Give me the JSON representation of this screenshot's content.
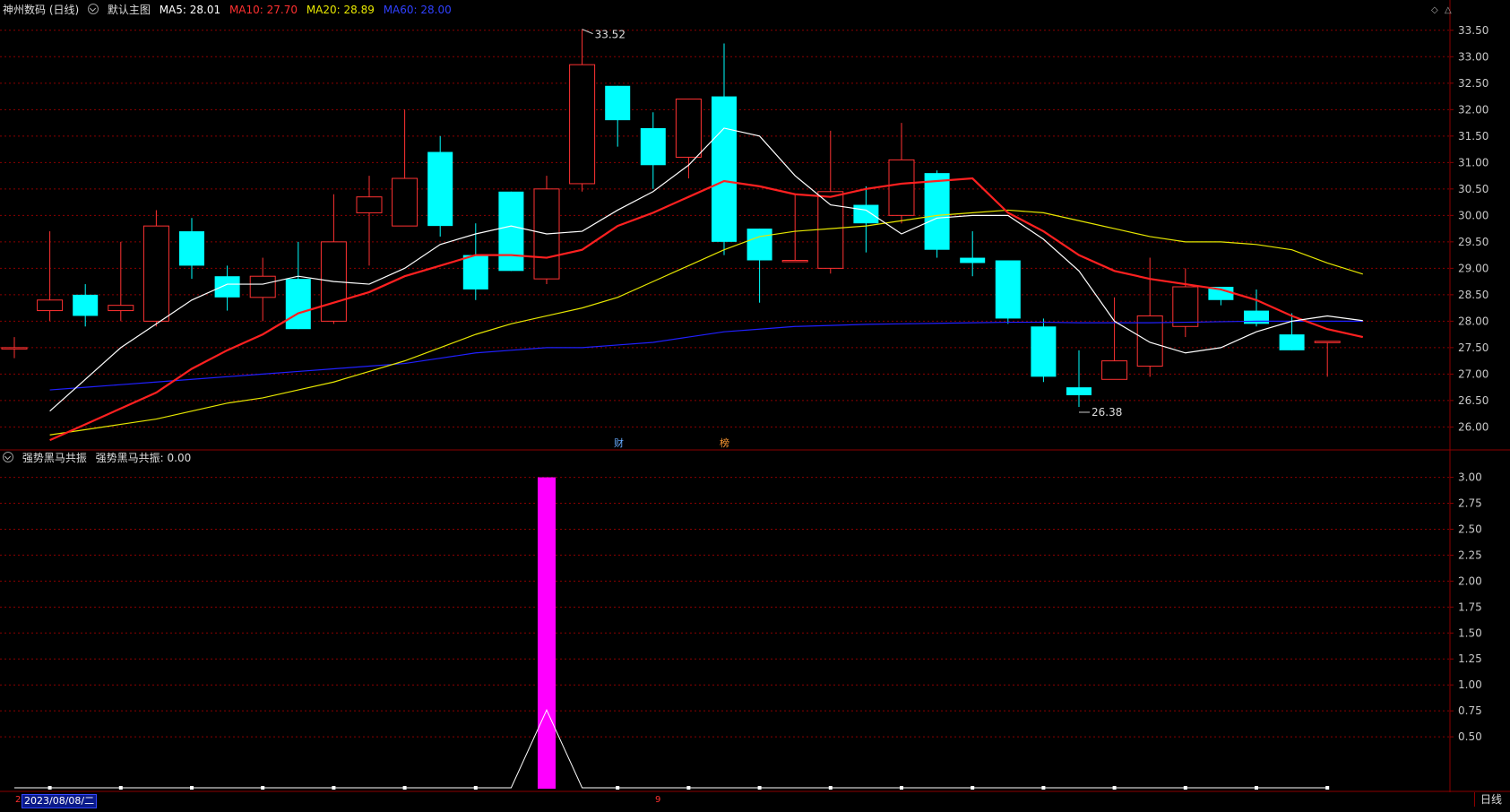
{
  "header": {
    "stock_title": "神州数码 (日线)",
    "main_chart_name": "默认主图",
    "ma5": "MA5: 28.01",
    "ma10": "MA10: 27.70",
    "ma20": "MA20: 28.89",
    "ma60": "MA60: 28.00"
  },
  "indicator": {
    "title": "强势黑马共振",
    "value_text": "强势黑马共振: 0.00"
  },
  "markers": {
    "high_label": "33.52",
    "low_label": "26.38",
    "fin_badge": "财",
    "rank_badge": "榜"
  },
  "footer": {
    "date": "2023/08/08/二",
    "period_button": "日线",
    "left_mark": "2",
    "mid_mark": "9"
  },
  "colors": {
    "up": "#ff3232",
    "down": "#00ffff",
    "ma5": "#ffffff",
    "ma10": "#ff2020",
    "ma20": "#e6e600",
    "ma60": "#2020ff",
    "indicator_bar": "#ff00ff",
    "grid": "#8b0000"
  },
  "chart_data": [
    {
      "type": "candlestick",
      "title": "神州数码 (日线)",
      "ylim": [
        25.6,
        33.7
      ],
      "yticks": [
        "33.50",
        "33.00",
        "32.50",
        "32.00",
        "31.50",
        "31.00",
        "30.50",
        "30.00",
        "29.50",
        "29.00",
        "28.50",
        "28.00",
        "27.50",
        "27.00",
        "26.50",
        "26.00"
      ],
      "candles": [
        {
          "o": 27.5,
          "h": 27.7,
          "l": 27.3,
          "c": 27.5
        },
        {
          "o": 28.2,
          "h": 29.7,
          "l": 28.0,
          "c": 28.4
        },
        {
          "o": 28.5,
          "h": 28.7,
          "l": 27.9,
          "c": 28.1
        },
        {
          "o": 28.2,
          "h": 29.5,
          "l": 28.0,
          "c": 28.3
        },
        {
          "o": 28.0,
          "h": 30.1,
          "l": 27.9,
          "c": 29.8
        },
        {
          "o": 29.7,
          "h": 29.95,
          "l": 28.8,
          "c": 29.05
        },
        {
          "o": 28.85,
          "h": 29.05,
          "l": 28.2,
          "c": 28.45
        },
        {
          "o": 28.45,
          "h": 29.2,
          "l": 28.0,
          "c": 28.85
        },
        {
          "o": 28.8,
          "h": 29.5,
          "l": 27.85,
          "c": 27.85
        },
        {
          "o": 28.0,
          "h": 30.4,
          "l": 27.95,
          "c": 29.5
        },
        {
          "o": 30.05,
          "h": 30.75,
          "l": 29.05,
          "c": 30.35
        },
        {
          "o": 29.8,
          "h": 32.0,
          "l": 29.8,
          "c": 30.7
        },
        {
          "o": 31.2,
          "h": 31.5,
          "l": 29.6,
          "c": 29.8
        },
        {
          "o": 29.25,
          "h": 29.85,
          "l": 28.4,
          "c": 28.6
        },
        {
          "o": 30.45,
          "h": 30.45,
          "l": 28.95,
          "c": 28.95
        },
        {
          "o": 28.8,
          "h": 30.75,
          "l": 28.7,
          "c": 30.5
        },
        {
          "o": 30.6,
          "h": 33.52,
          "l": 30.45,
          "c": 32.85
        },
        {
          "o": 32.45,
          "h": 32.45,
          "l": 31.3,
          "c": 31.8
        },
        {
          "o": 31.65,
          "h": 31.95,
          "l": 30.5,
          "c": 30.95
        },
        {
          "o": 31.1,
          "h": 32.2,
          "l": 30.7,
          "c": 32.2
        },
        {
          "o": 32.25,
          "h": 33.25,
          "l": 29.25,
          "c": 29.5
        },
        {
          "o": 29.75,
          "h": 29.75,
          "l": 28.35,
          "c": 29.15
        },
        {
          "o": 29.15,
          "h": 30.4,
          "l": 29.15,
          "c": 29.15
        },
        {
          "o": 29.0,
          "h": 31.6,
          "l": 28.9,
          "c": 30.45
        },
        {
          "o": 30.2,
          "h": 30.55,
          "l": 29.3,
          "c": 29.85
        },
        {
          "o": 30.0,
          "h": 31.75,
          "l": 29.85,
          "c": 31.05
        },
        {
          "o": 30.8,
          "h": 30.85,
          "l": 29.2,
          "c": 29.35
        },
        {
          "o": 29.2,
          "h": 29.7,
          "l": 28.85,
          "c": 29.1
        },
        {
          "o": 29.15,
          "h": 29.15,
          "l": 27.95,
          "c": 28.05
        },
        {
          "o": 27.9,
          "h": 28.05,
          "l": 26.85,
          "c": 26.95
        },
        {
          "o": 26.75,
          "h": 27.45,
          "l": 26.38,
          "c": 26.6
        },
        {
          "o": 26.9,
          "h": 28.45,
          "l": 26.9,
          "c": 27.25
        },
        {
          "o": 27.15,
          "h": 29.2,
          "l": 26.95,
          "c": 28.1
        },
        {
          "o": 27.9,
          "h": 29.0,
          "l": 27.7,
          "c": 28.65
        },
        {
          "o": 28.65,
          "h": 28.65,
          "l": 28.3,
          "c": 28.4
        },
        {
          "o": 28.2,
          "h": 28.6,
          "l": 27.9,
          "c": 27.95
        },
        {
          "o": 27.75,
          "h": 28.15,
          "l": 27.45,
          "c": 27.45
        },
        {
          "o": 27.62,
          "h": 27.62,
          "l": 26.95,
          "c": 27.62
        }
      ],
      "ma5": [
        26.3,
        26.9,
        27.5,
        27.95,
        28.4,
        28.7,
        28.7,
        28.85,
        28.75,
        28.7,
        29.0,
        29.45,
        29.65,
        29.8,
        29.65,
        29.7,
        30.1,
        30.45,
        30.95,
        31.65,
        31.5,
        30.75,
        30.2,
        30.1,
        29.65,
        29.95,
        30.0,
        30.0,
        29.55,
        28.95,
        28.0,
        27.6,
        27.4,
        27.5,
        27.8,
        28.0,
        28.1,
        28.01
      ],
      "ma10": [
        25.75,
        26.05,
        26.35,
        26.65,
        27.1,
        27.45,
        27.75,
        28.15,
        28.35,
        28.55,
        28.85,
        29.05,
        29.25,
        29.25,
        29.2,
        29.35,
        29.8,
        30.05,
        30.35,
        30.65,
        30.55,
        30.4,
        30.35,
        30.5,
        30.6,
        30.65,
        30.7,
        30.05,
        29.7,
        29.25,
        28.95,
        28.8,
        28.7,
        28.6,
        28.4,
        28.1,
        27.85,
        27.7
      ],
      "ma20": [
        25.85,
        25.95,
        26.05,
        26.15,
        26.3,
        26.45,
        26.55,
        26.7,
        26.85,
        27.05,
        27.25,
        27.5,
        27.75,
        27.95,
        28.1,
        28.25,
        28.45,
        28.75,
        29.05,
        29.35,
        29.6,
        29.7,
        29.75,
        29.8,
        29.9,
        30.0,
        30.05,
        30.1,
        30.05,
        29.9,
        29.75,
        29.6,
        29.5,
        29.5,
        29.45,
        29.35,
        29.1,
        28.89
      ],
      "ma60": [
        26.7,
        26.75,
        26.8,
        26.85,
        26.9,
        26.95,
        27.0,
        27.05,
        27.1,
        27.15,
        27.2,
        27.3,
        27.4,
        27.45,
        27.5,
        27.5,
        27.55,
        27.6,
        27.7,
        27.8,
        27.85,
        27.9,
        27.92,
        27.94,
        27.95,
        27.96,
        27.97,
        27.98,
        27.98,
        27.97,
        27.97,
        27.97,
        27.98,
        27.99,
        28.0,
        28.0,
        28.0,
        28.0
      ]
    },
    {
      "type": "bar",
      "title": "强势黑马共振",
      "ylim": [
        0,
        3.1
      ],
      "yticks": [
        "3.00",
        "2.75",
        "2.50",
        "2.25",
        "2.00",
        "1.75",
        "1.50",
        "1.25",
        "1.00",
        "0.75",
        "0.50"
      ],
      "values": [
        0,
        0,
        0,
        0,
        0,
        0,
        0,
        0,
        0,
        0,
        0,
        0,
        0,
        0,
        0,
        3,
        0,
        0,
        0,
        0,
        0,
        0,
        0,
        0,
        0,
        0,
        0,
        0,
        0,
        0,
        0,
        0,
        0,
        0,
        0,
        0,
        0,
        0
      ],
      "line": [
        0,
        0,
        0,
        0,
        0,
        0,
        0,
        0,
        0,
        0,
        0,
        0,
        0,
        0,
        0,
        0.75,
        0,
        0,
        0,
        0,
        0,
        0,
        0,
        0,
        0,
        0,
        0,
        0,
        0,
        0,
        0,
        0,
        0,
        0,
        0,
        0,
        0,
        0
      ]
    }
  ]
}
